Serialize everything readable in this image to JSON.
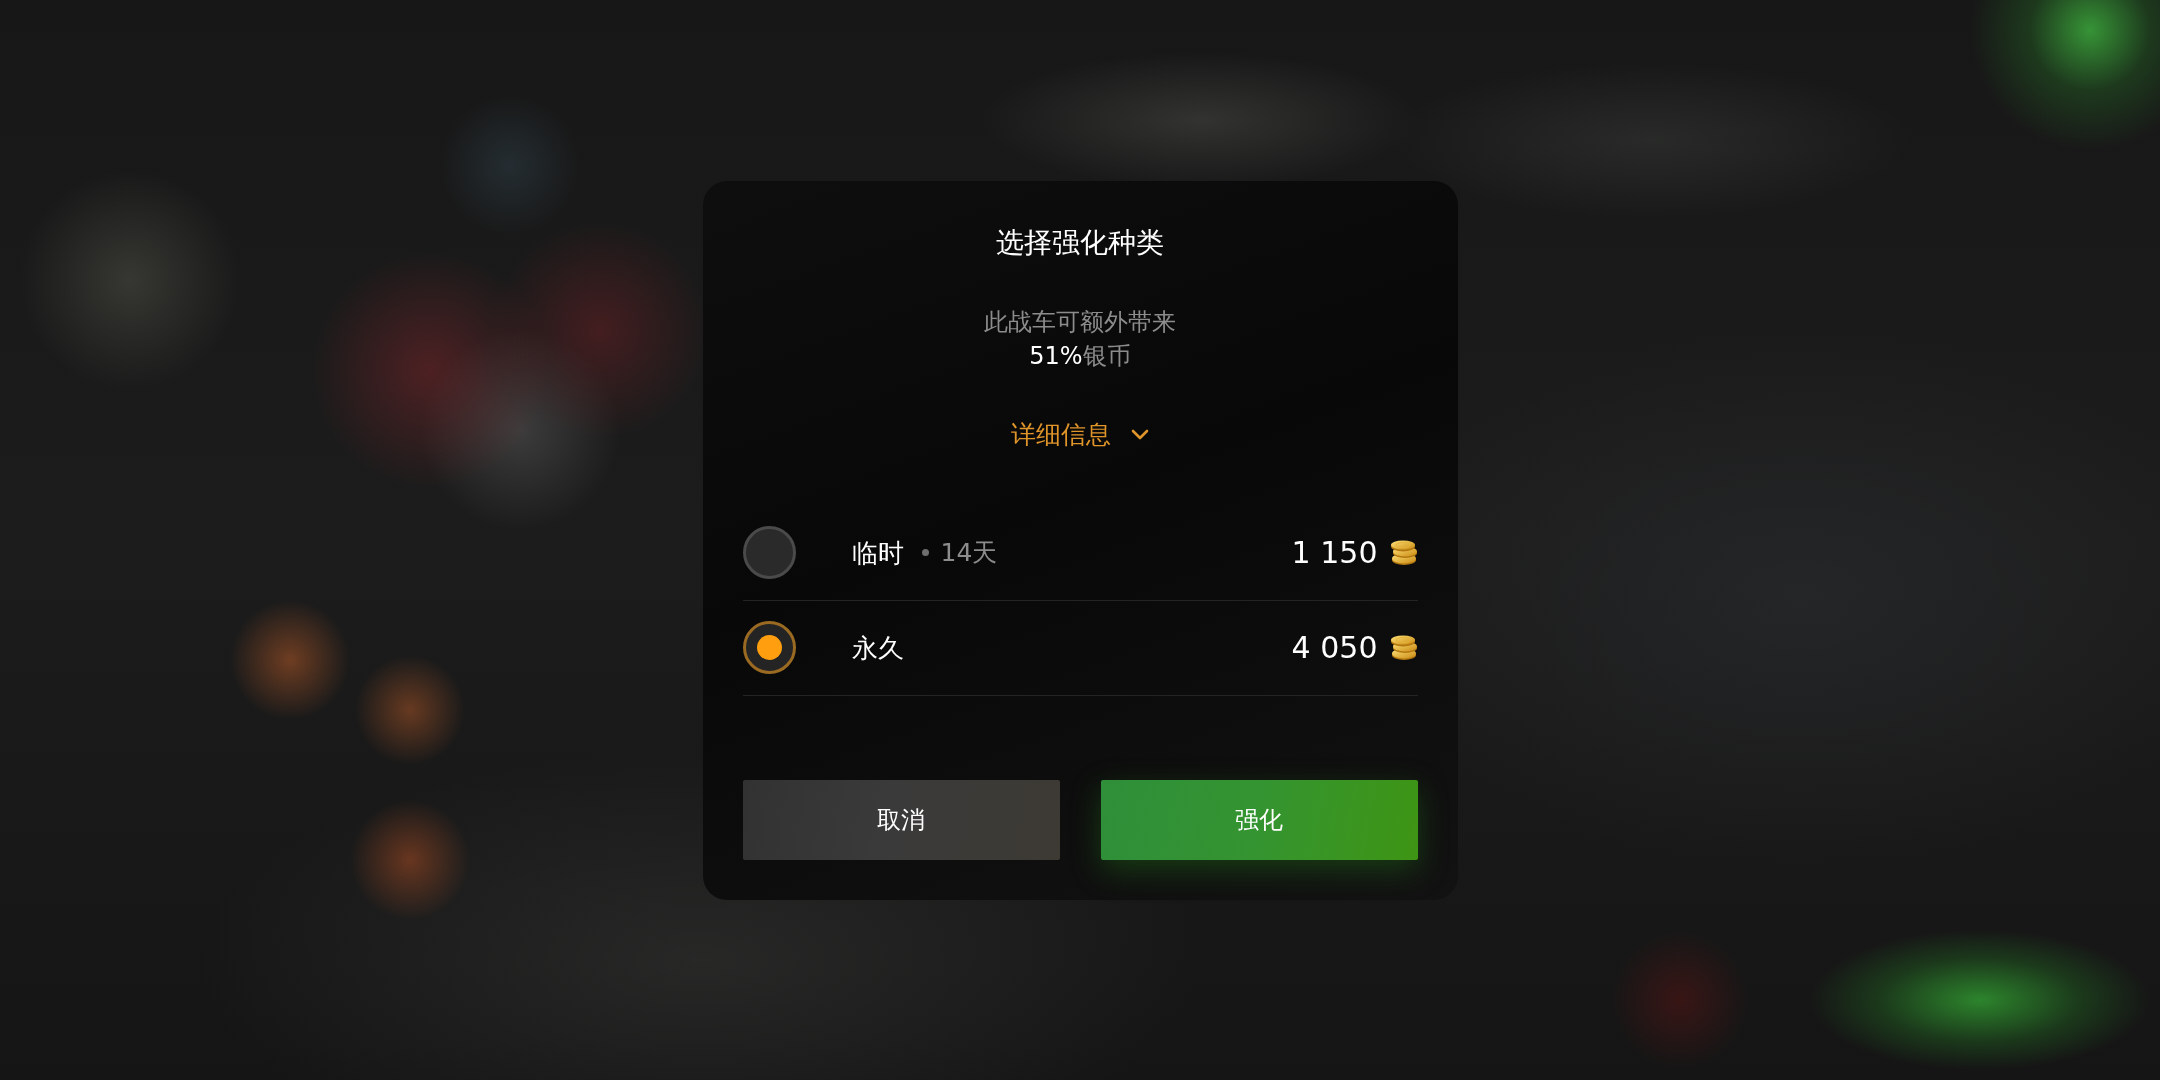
{
  "dialog": {
    "title": "选择强化种类",
    "description_lines": [
      "此战车可额外带来",
      "**51%**银币"
    ],
    "details_toggle": {
      "label": "详细信息",
      "expanded": false
    },
    "options": [
      {
        "label": "临时",
        "duration": "14天",
        "price": "1 150",
        "selected": false
      },
      {
        "label": "永久",
        "price": "4 050",
        "selected": true
      }
    ],
    "buttons": [
      {
        "label": "取消",
        "kind": "secondary"
      },
      {
        "label": "强化",
        "kind": "primary"
      }
    ]
  }
}
